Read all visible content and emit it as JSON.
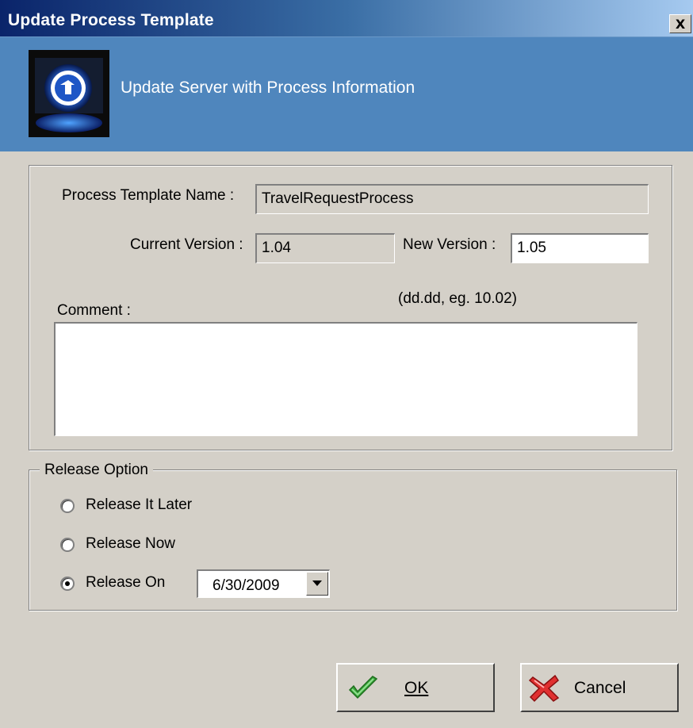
{
  "window": {
    "title": "Update Process Template",
    "close_label": "X"
  },
  "banner": {
    "subtitle": "Update Server with Process Information"
  },
  "form": {
    "template_name_label": "Process Template Name :",
    "template_name_value": "TravelRequestProcess",
    "current_version_label": "Current Version :",
    "current_version_value": "1.04",
    "new_version_label": "New Version :",
    "new_version_value": "1.05",
    "version_hint": "(dd.dd, eg. 10.02)",
    "comment_label": "Comment :",
    "comment_value": ""
  },
  "release": {
    "legend": "Release Option",
    "options": [
      {
        "label": "Release It Later",
        "checked": false
      },
      {
        "label": "Release Now",
        "checked": false
      },
      {
        "label": "Release On",
        "checked": true
      }
    ],
    "date_value": "6/30/2009"
  },
  "buttons": {
    "ok_label": "OK",
    "cancel_label": "Cancel"
  },
  "icons": [
    "logo-icon",
    "close-icon",
    "dropdown-arrow-icon",
    "check-icon",
    "x-icon"
  ]
}
